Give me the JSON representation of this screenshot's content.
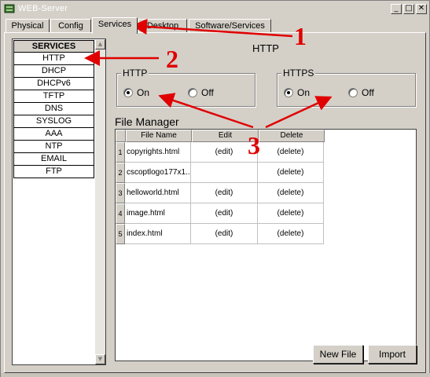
{
  "window": {
    "title": "WEB-Server"
  },
  "tabs": [
    {
      "label": "Physical"
    },
    {
      "label": "Config"
    },
    {
      "label": "Services",
      "active": true
    },
    {
      "label": "Desktop"
    },
    {
      "label": "Software/Services"
    }
  ],
  "services": {
    "header": "SERVICES",
    "items": [
      "HTTP",
      "DHCP",
      "DHCPv6",
      "TFTP",
      "DNS",
      "SYSLOG",
      "AAA",
      "NTP",
      "EMAIL",
      "FTP"
    ],
    "selected": "HTTP"
  },
  "main": {
    "title": "HTTP",
    "http_group": {
      "label": "HTTP",
      "on_label": "On",
      "off_label": "Off",
      "value": "On"
    },
    "https_group": {
      "label": "HTTPS",
      "on_label": "On",
      "off_label": "Off",
      "value": "On"
    },
    "file_manager": {
      "title": "File Manager",
      "columns": [
        "File Name",
        "Edit",
        "Delete"
      ],
      "rows": [
        {
          "num": "1",
          "name": "copyrights.html",
          "edit": "(edit)",
          "delete": "(delete)"
        },
        {
          "num": "2",
          "name": "cscoptlogo177x1...",
          "edit": "",
          "delete": "(delete)"
        },
        {
          "num": "3",
          "name": "helloworld.html",
          "edit": "(edit)",
          "delete": "(delete)"
        },
        {
          "num": "4",
          "name": "image.html",
          "edit": "(edit)",
          "delete": "(delete)"
        },
        {
          "num": "5",
          "name": "index.html",
          "edit": "(edit)",
          "delete": "(delete)"
        }
      ]
    },
    "buttons": {
      "new_file": "New File",
      "import": "Import"
    }
  },
  "annotations": {
    "one": "1",
    "two": "2",
    "three": "3",
    "color": "#e00000"
  },
  "colors": {
    "titlebar_bg": "#d4d0c8",
    "panel_bg": "#d4d0c8"
  }
}
